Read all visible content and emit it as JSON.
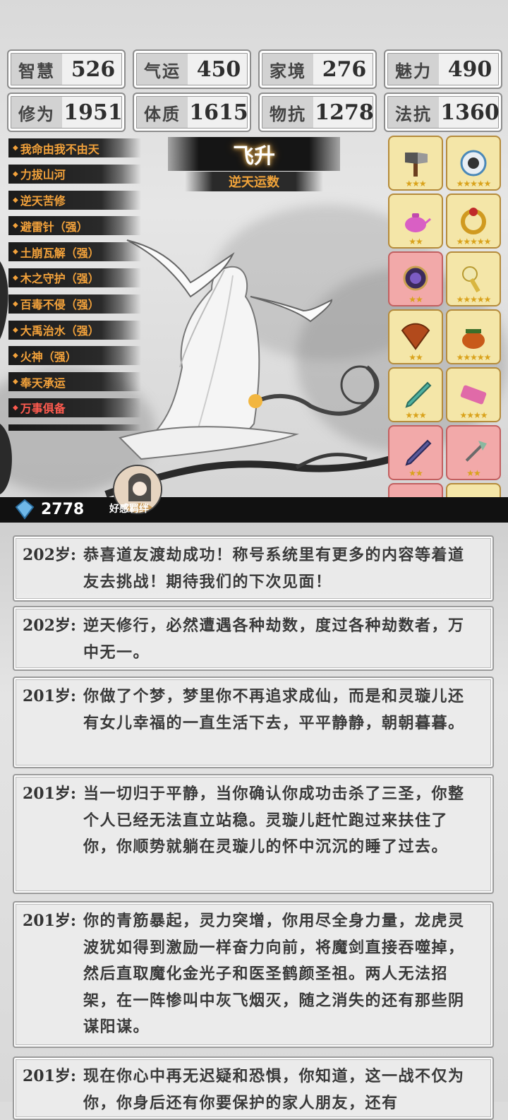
{
  "stats": [
    {
      "label": "智慧",
      "value": "526"
    },
    {
      "label": "气运",
      "value": "450"
    },
    {
      "label": "家境",
      "value": "276"
    },
    {
      "label": "魅力",
      "value": "490"
    },
    {
      "label": "修为",
      "value": "1951"
    },
    {
      "label": "体质",
      "value": "1615"
    },
    {
      "label": "物抗",
      "value": "1278"
    },
    {
      "label": "法抗",
      "value": "1360"
    }
  ],
  "skills": [
    {
      "label": "我命由我不由天",
      "color": "orange"
    },
    {
      "label": "力拔山河",
      "color": "orange"
    },
    {
      "label": "逆天苦修",
      "color": "orange"
    },
    {
      "label": "避雷针（强）",
      "color": "orange"
    },
    {
      "label": "土崩瓦解（强）",
      "color": "orange"
    },
    {
      "label": "木之守护（强）",
      "color": "orange"
    },
    {
      "label": "百毒不侵（强）",
      "color": "orange"
    },
    {
      "label": "大禹治水（强）",
      "color": "orange"
    },
    {
      "label": "火神（强）",
      "color": "orange"
    },
    {
      "label": "奉天承运",
      "color": "orange"
    },
    {
      "label": "万事俱备",
      "color": "red"
    }
  ],
  "ascend": {
    "title": "飞升",
    "subtitle": "逆天运数"
  },
  "items": [
    {
      "icon": "axe-icon",
      "stars": "★★★",
      "bg": "gold"
    },
    {
      "icon": "shell-icon",
      "stars": "★★★★★",
      "bg": "gold"
    },
    {
      "icon": "teapot-icon",
      "stars": "★★",
      "bg": "gold"
    },
    {
      "icon": "ring-icon",
      "stars": "★★★★★",
      "bg": "gold"
    },
    {
      "icon": "mirror-icon",
      "stars": "★★",
      "bg": "red"
    },
    {
      "icon": "rattle-icon",
      "stars": "★★★★★",
      "bg": "gold"
    },
    {
      "icon": "fan-icon",
      "stars": "★★",
      "bg": "gold"
    },
    {
      "icon": "cauldron-icon",
      "stars": "★★★★★",
      "bg": "gold"
    },
    {
      "icon": "jade-sword-icon",
      "stars": "★★★",
      "bg": "gold"
    },
    {
      "icon": "scroll-icon",
      "stars": "★★★★",
      "bg": "gold"
    },
    {
      "icon": "dark-sword-icon",
      "stars": "★★",
      "bg": "red"
    },
    {
      "icon": "halberd-icon",
      "stars": "★★",
      "bg": "red"
    },
    {
      "icon": "gold-sword-icon",
      "stars": "★★★★",
      "bg": "red"
    },
    {
      "icon": "fire-orb-icon",
      "stars": "★★",
      "bg": "gold"
    }
  ],
  "currency": {
    "amount": "2778"
  },
  "companion": {
    "label": "好感羁绊"
  },
  "log": [
    {
      "age": "202岁:",
      "text": "恭喜道友渡劫成功！称号系统里有更多的内容等着道友去挑战！期待我们的下次见面！"
    },
    {
      "age": "202岁:",
      "text": "逆天修行，必然遭遇各种劫数，度过各种劫数者，万中无一。"
    },
    {
      "age": "201岁:",
      "text": "你做了个梦，梦里你不再追求成仙，而是和灵璇儿还有女儿幸福的一直生活下去，平平静静，朝朝暮暮。"
    },
    {
      "age": "201岁:",
      "text": "当一切归于平静，当你确认你成功击杀了三圣，你整个人已经无法直立站稳。灵璇儿赶忙跑过来扶住了你，你顺势就躺在灵璇儿的怀中沉沉的睡了过去。"
    },
    {
      "age": "201岁:",
      "text": "你的青筋暴起，灵力突增，你用尽全身力量，龙虎灵波犹如得到激励一样奋力向前，将魔剑直接吞噬掉，然后直取魔化金光子和医圣鹤颜圣祖。两人无法招架，在一阵惨叫中灰飞烟灭，随之消失的还有那些阴谋阳谋。"
    },
    {
      "age": "201岁:",
      "text": "现在你心中再无迟疑和恐惧，你知道，这一战不仅为你，你身后还有你要保护的家人朋友，还有"
    }
  ]
}
